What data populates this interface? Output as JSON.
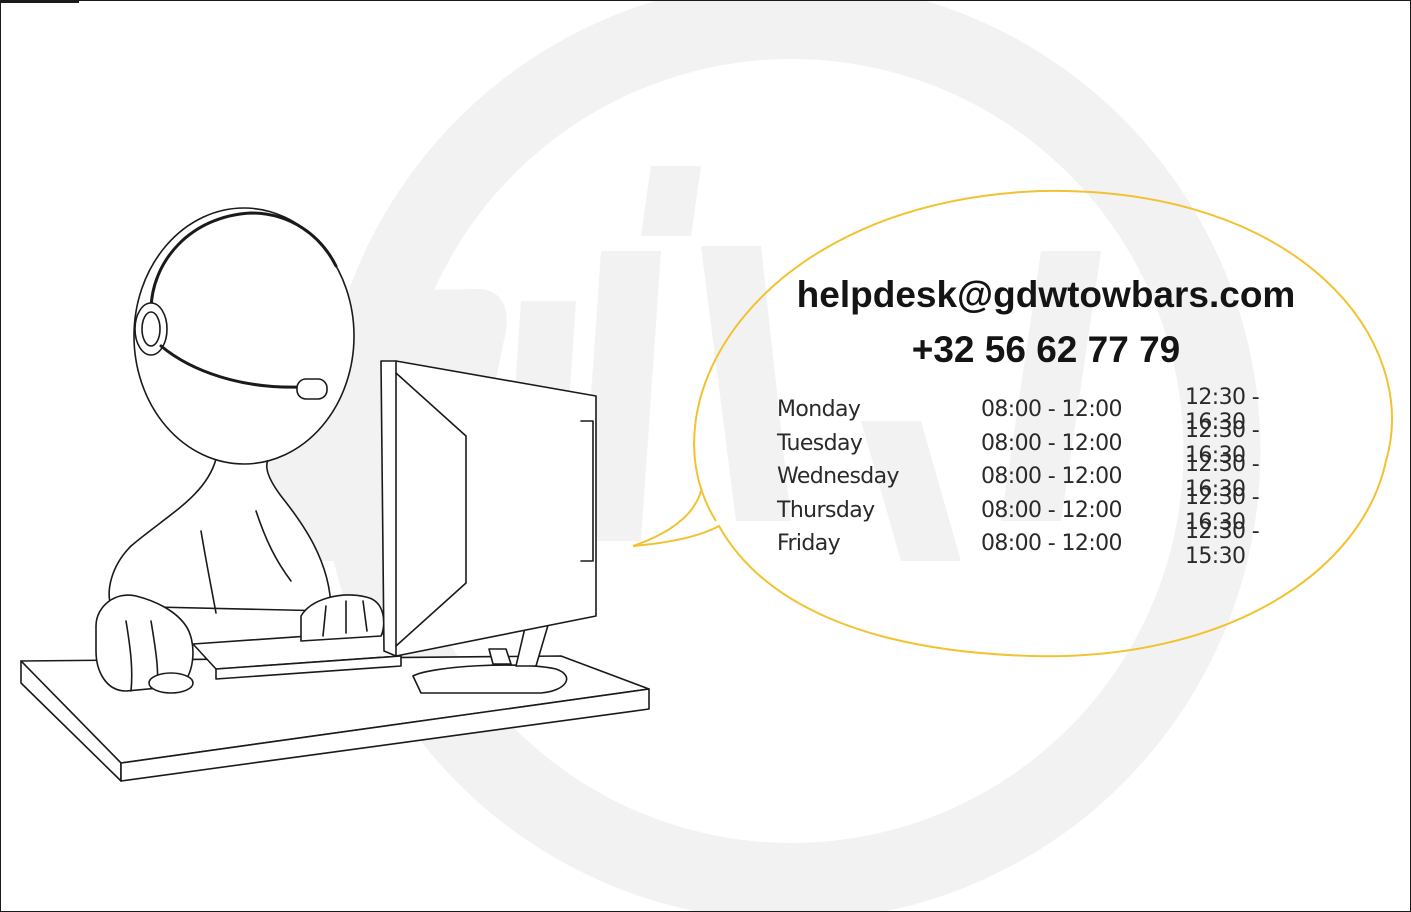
{
  "contact": {
    "email": "helpdesk@gdwtowbars.com",
    "phone": "+32 56 62 77 79"
  },
  "hours": [
    {
      "day": "Monday",
      "morning": "08:00 - 12:00",
      "afternoon": "12:30 - 16:30"
    },
    {
      "day": "Tuesday",
      "morning": "08:00 - 12:00",
      "afternoon": "12:30 - 16:30"
    },
    {
      "day": "Wednesday",
      "morning": "08:00 - 12:00",
      "afternoon": "12:30 - 16:30"
    },
    {
      "day": "Thursday",
      "morning": "08:00 - 12:00",
      "afternoon": "12:30 - 16:30"
    },
    {
      "day": "Friday",
      "morning": "08:00 - 12:00",
      "afternoon": "12:30 - 15:30"
    }
  ],
  "colors": {
    "speech_bubble_outline": "#f2c231",
    "watermark": "#f2f2f2",
    "line_art": "#1a1a1a",
    "text": "#141414"
  },
  "icons": {
    "watermark": "gdw-logo-watermark",
    "illustration": "helpdesk-operator-at-computer"
  }
}
